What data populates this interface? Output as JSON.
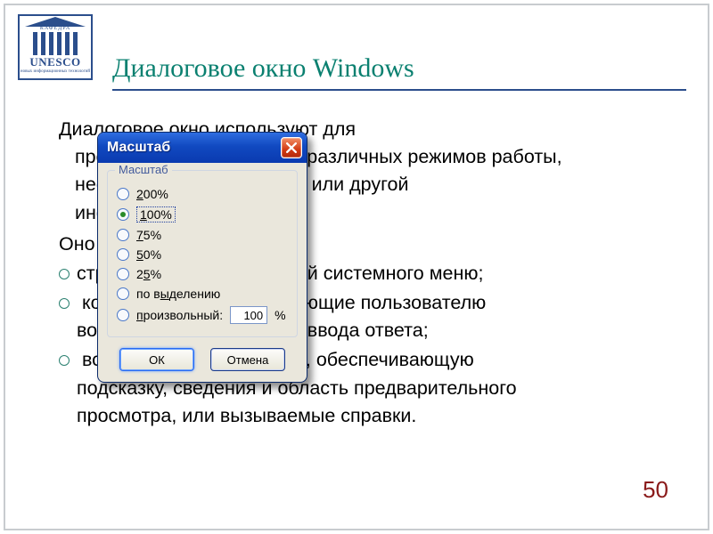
{
  "logo": {
    "brand": "UNESCO",
    "topword": "КАФЕДРА",
    "subtitle": "новых информационных технологий"
  },
  "heading": "Диалоговое окно Windows",
  "textlines": {
    "para1_l1": "Диалоговое окно используют для",
    "para1_l2": "просмотра или установки различных режимов работы,",
    "para1_l3": "необходимых параметров или другой",
    "para1_l4": "информации.",
    "para2": "Оно может содержать:",
    "li1": "строку заголовка с кнопкой системного меню;",
    "li2_l1": "компоненты, обеспечивающие пользователю",
    "li2_l2": "возможность выбора или ввода ответа;",
    "li3_l1": "вспомогательную панель, обеспечивающую",
    "li3_l2": "подсказку, сведения и область предварительного",
    "li3_l3": "просмотра, или вызываемые справки."
  },
  "page_num": "50",
  "dialog": {
    "title": "Масштаб",
    "legend": "Масштаб",
    "options": {
      "o200": "200%",
      "o100": "100%",
      "o75": "75%",
      "o50": "50%",
      "o25": "25%",
      "fit": "по выделению",
      "custom": "произвольный:"
    },
    "custom_value": "100",
    "percent_sign": "%",
    "ok": "ОК",
    "cancel": "Отмена"
  }
}
